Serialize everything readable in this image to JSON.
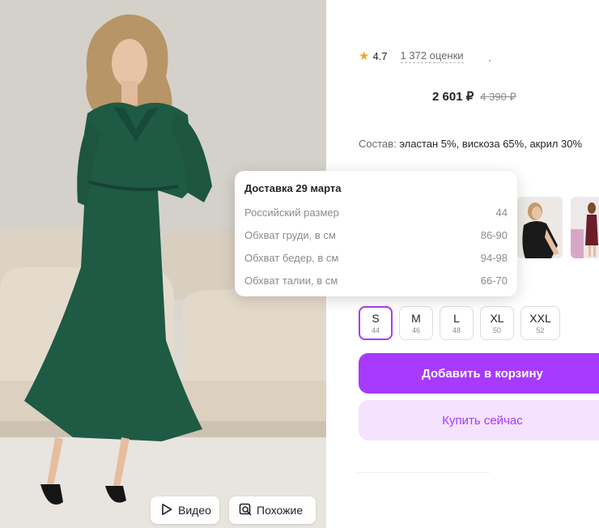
{
  "photo": {
    "video_label": "Видео",
    "similar_label": "Похожие"
  },
  "product": {
    "rating": "4.7",
    "reviews": "1 372 оценки",
    "price_now": "2 601 ₽",
    "price_old": "4 390 ₽",
    "composition_label": "Состав:",
    "composition_value": "эластан 5%, вискоза 65%, акрил 30%"
  },
  "size_popup": {
    "title": "Доставка 29 марта",
    "rows": [
      {
        "label": "Российский размер",
        "value": "44"
      },
      {
        "label": "Обхват груди, в см",
        "value": "86-90"
      },
      {
        "label": "Обхват бедер, в см",
        "value": "94-98"
      },
      {
        "label": "Обхват талии, в см",
        "value": "66-70"
      }
    ]
  },
  "sizes": [
    {
      "name": "S",
      "ru": "44",
      "selected": true
    },
    {
      "name": "M",
      "ru": "46",
      "selected": false
    },
    {
      "name": "L",
      "ru": "48",
      "selected": false
    },
    {
      "name": "XL",
      "ru": "50",
      "selected": false
    },
    {
      "name": "XXL",
      "ru": "52",
      "selected": false
    }
  ],
  "actions": {
    "add_to_cart": "Добавить в корзину",
    "buy_now": "Купить сейчас"
  },
  "colors": {
    "accent": "#a73afd",
    "accent_light": "#f4e2ff",
    "star": "#f5a623",
    "dress": "#1f5a45"
  },
  "icons": {
    "video": "play-icon",
    "similar": "similar-search-icon",
    "rating": "star-icon"
  }
}
